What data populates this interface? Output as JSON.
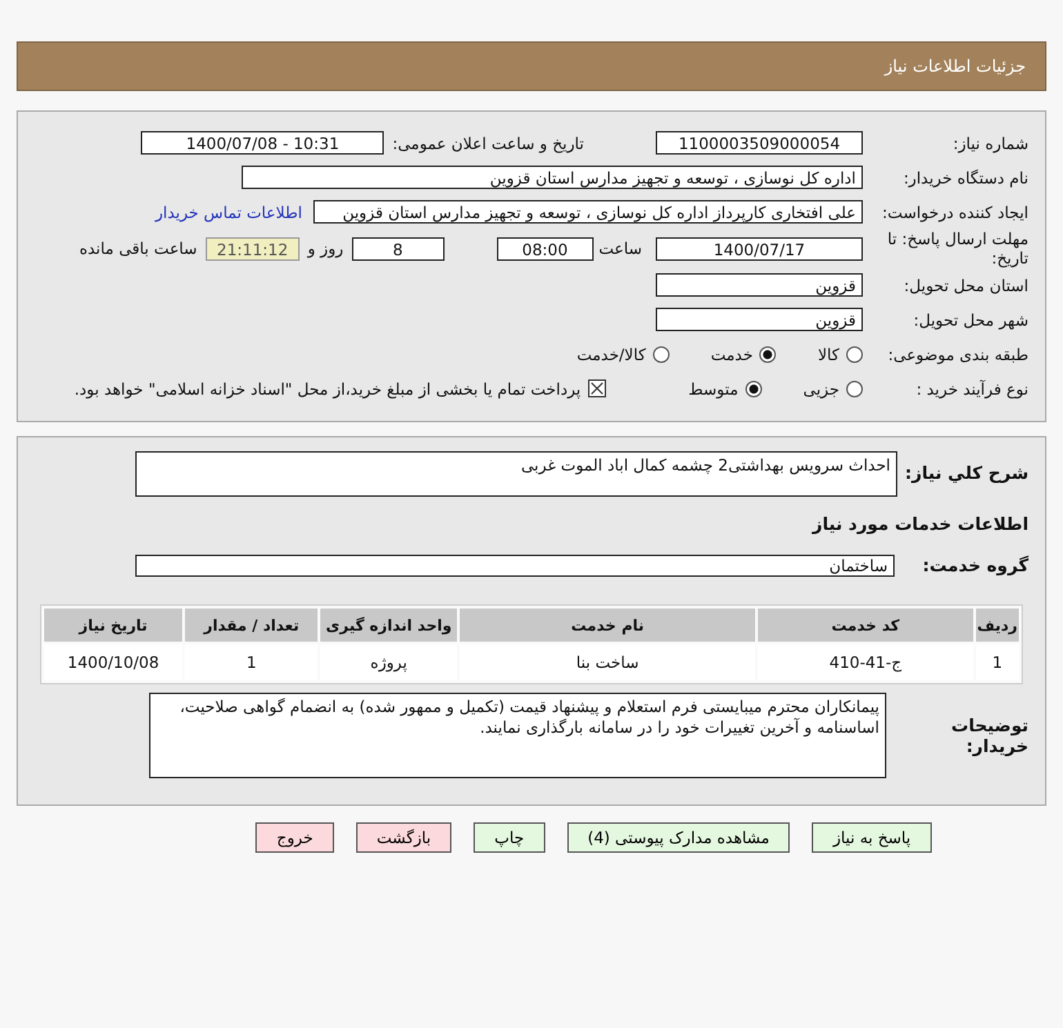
{
  "header": {
    "title": "جزئیات اطلاعات نیاز"
  },
  "details": {
    "need_number": {
      "label": "شماره نیاز:",
      "value": "1100003509000054"
    },
    "announce": {
      "label": "تاریخ و ساعت اعلان عمومی:",
      "value": "1400/07/08 - 10:31"
    },
    "buyer_org": {
      "label": "نام دستگاه خریدار:",
      "value": "اداره کل نوسازی ، توسعه و تجهیز مدارس استان قزوین"
    },
    "requester": {
      "label": "ایجاد کننده درخواست:",
      "value": "علی افتخاری کارپرداز اداره کل نوسازی ، توسعه و تجهیز مدارس استان قزوین",
      "link": "اطلاعات تماس خریدار"
    },
    "deadline": {
      "label": "مهلت ارسال پاسخ: تا تاریخ:",
      "date": "1400/07/17",
      "time_label": "ساعت",
      "time": "08:00",
      "days": "8",
      "days_label": "روز و",
      "remaining": "21:11:12",
      "remaining_label": "ساعت باقی مانده"
    },
    "province": {
      "label": "استان محل تحویل:",
      "value": "قزوین"
    },
    "city": {
      "label": "شهر محل تحویل:",
      "value": "قزوین"
    },
    "category": {
      "label": "طبقه بندی موضوعی:",
      "options": [
        {
          "label": "کالا",
          "selected": false
        },
        {
          "label": "خدمت",
          "selected": true
        },
        {
          "label": "کالا/خدمت",
          "selected": false
        }
      ]
    },
    "process": {
      "label": "نوع فرآیند خرید :",
      "options": [
        {
          "label": "جزیی",
          "selected": false
        },
        {
          "label": "متوسط",
          "selected": true
        }
      ],
      "payment": {
        "checked": true,
        "label": "پرداخت تمام یا بخشی از مبلغ خرید،از محل \"اسناد خزانه اسلامی\" خواهد بود."
      }
    }
  },
  "summary": {
    "label": "شرح کلي نياز:",
    "value": "احداث سرویس بهداشتی2 چشمه کمال اباد الموت غربی"
  },
  "services_heading": "اطلاعات خدمات مورد نیاز",
  "service_group": {
    "label": "گروه خدمت:",
    "value": "ساختمان"
  },
  "table": {
    "columns": [
      "ردیف",
      "کد خدمت",
      "نام خدمت",
      "واحد اندازه گیری",
      "تعداد / مقدار",
      "تاریخ نیاز"
    ],
    "rows": [
      [
        "1",
        "ج-41-410",
        "ساخت بنا",
        "پروژه",
        "1",
        "1400/10/08"
      ]
    ]
  },
  "buyer_notes": {
    "label": "توضیحات خریدار:",
    "value": "پیمانکاران محترم میبایستی فرم استعلام و پیشنهاد قیمت (تکمیل و ممهور شده) به انضمام گواهی صلاحیت، اساسنامه و آخرین تغییرات خود را در سامانه بارگذاری نمایند."
  },
  "buttons": [
    {
      "label": "پاسخ به نیاز",
      "kind": "action"
    },
    {
      "label": "مشاهده مدارک پیوستی (4)",
      "kind": "action"
    },
    {
      "label": "چاپ",
      "kind": "action"
    },
    {
      "label": "بازگشت",
      "kind": "danger"
    },
    {
      "label": "خروج",
      "kind": "danger"
    }
  ]
}
